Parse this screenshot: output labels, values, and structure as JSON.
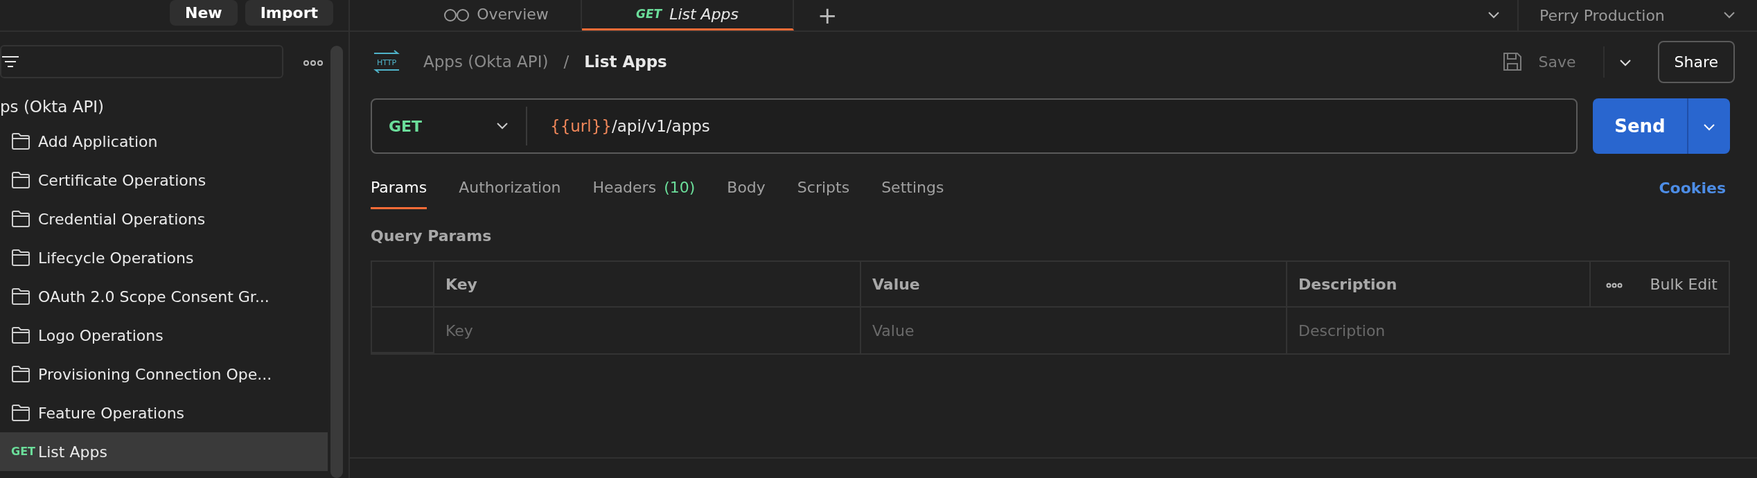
{
  "top_bar": {
    "buttons": [
      "New",
      "Import"
    ],
    "tabs": [
      {
        "kind": "overview",
        "label": "Overview",
        "selected": false
      },
      {
        "kind": "request",
        "method": "GET",
        "label": "List Apps",
        "selected": true
      }
    ],
    "new_tab": "+",
    "environment": "Perry Production"
  },
  "sidebar": {
    "collection": "ps (Okta API)",
    "items": [
      {
        "kind": "folder",
        "label": "Add Application",
        "selected": false
      },
      {
        "kind": "folder",
        "label": "Certificate Operations",
        "selected": false
      },
      {
        "kind": "folder",
        "label": "Credential Operations",
        "selected": false
      },
      {
        "kind": "folder",
        "label": "Lifecycle Operations",
        "selected": false
      },
      {
        "kind": "folder",
        "label": "OAuth 2.0 Scope Consent Gr...",
        "selected": false
      },
      {
        "kind": "folder",
        "label": "Logo Operations",
        "selected": false
      },
      {
        "kind": "folder",
        "label": "Provisioning Connection Ope...",
        "selected": false
      },
      {
        "kind": "folder",
        "label": "Feature Operations",
        "selected": false
      },
      {
        "kind": "request",
        "method": "GET",
        "label": "List Apps",
        "selected": true
      }
    ]
  },
  "request": {
    "icon_text": "HTTP",
    "breadcrumb": {
      "parent": "Apps (Okta API)",
      "separator": "/",
      "current": "List Apps"
    },
    "save": "Save",
    "share": "Share",
    "method": "GET",
    "url": [
      {
        "kind": "variable",
        "text": "{{url}}"
      },
      {
        "kind": "text",
        "text": "/api/v1/apps"
      }
    ],
    "send": "Send",
    "tabs": [
      {
        "label": "Params",
        "selected": true
      },
      {
        "label": "Authorization",
        "selected": false
      },
      {
        "label": "Headers",
        "count": "(10)",
        "selected": false
      },
      {
        "label": "Body",
        "selected": false
      },
      {
        "label": "Scripts",
        "selected": false
      },
      {
        "label": "Settings",
        "selected": false
      }
    ],
    "cookies": "Cookies",
    "params": {
      "title": "Query Params",
      "columns": [
        "Key",
        "Value",
        "Description"
      ],
      "bulk_edit": "Bulk Edit",
      "placeholders": [
        "Key",
        "Value",
        "Description"
      ]
    }
  }
}
